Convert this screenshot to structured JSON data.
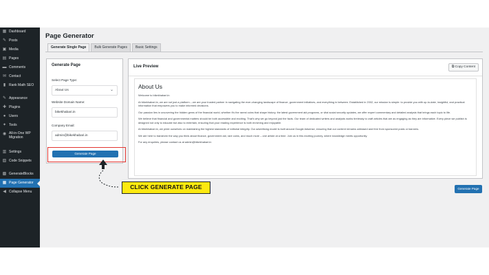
{
  "sidebar": {
    "items": [
      {
        "icon": "dashboard-icon",
        "glyph": "▦",
        "label": "Dashboard"
      },
      {
        "icon": "pin-icon",
        "glyph": "✎",
        "label": "Posts"
      },
      {
        "icon": "media-icon",
        "glyph": "▣",
        "label": "Media"
      },
      {
        "icon": "pages-icon",
        "glyph": "▤",
        "label": "Pages"
      },
      {
        "icon": "comment-icon",
        "glyph": "▬",
        "label": "Comments"
      },
      {
        "icon": "mail-icon",
        "glyph": "✉",
        "label": "Contact"
      },
      {
        "icon": "chart-icon",
        "glyph": "▮",
        "label": "Rank Math SEO"
      },
      {
        "icon": "brush-icon",
        "glyph": "✎",
        "label": "Appearance"
      },
      {
        "icon": "plugin-icon",
        "glyph": "✚",
        "label": "Plugins"
      },
      {
        "icon": "user-icon",
        "glyph": "●",
        "label": "Users"
      },
      {
        "icon": "wrench-icon",
        "glyph": "✦",
        "label": "Tools"
      },
      {
        "icon": "migration-icon",
        "glyph": "◉",
        "label": "All-in-One WP Migration"
      },
      {
        "icon": "settings-icon",
        "glyph": "▥",
        "label": "Settings"
      },
      {
        "icon": "code-icon",
        "glyph": "▧",
        "label": "Code Snippets"
      },
      {
        "icon": "blocks-icon",
        "glyph": "▩",
        "label": "GenerateBlocks"
      },
      {
        "icon": "page-gen-icon",
        "glyph": "▦",
        "label": "Page Generator"
      },
      {
        "icon": "collapse-icon",
        "glyph": "◀",
        "label": "Collapse Menu"
      }
    ]
  },
  "header": {
    "title": "Page Generator"
  },
  "tabs": [
    {
      "label": "Generate Single Page"
    },
    {
      "label": "Bulk Generate Pages"
    },
    {
      "label": "Basic Settings"
    }
  ],
  "form": {
    "title": "Generate Page",
    "page_type_label": "Select Page Type:",
    "page_type_value": "About Us",
    "domain_label": "Website Domain Name:",
    "domain_value": "bikekhabari.in",
    "email_label": "Company Email:",
    "email_value": "admin@bikekhabari.in",
    "button_label": "Generate Page"
  },
  "preview": {
    "title": "Live Preview",
    "copy_label": "Copy Content",
    "heading": "About Us",
    "paragraphs": [
      "Welcome to bikekhabari.in",
      "At bikekhabari.in, we are not just a platform – we are your trusted partner in navigating the ever-changing landscape of finance, government initiatives, and everything in between. Established in 2002, our mission is simple: to provide you with up-to-date, insightful, and practical information that empowers you to make informed decisions.",
      "Our passion lies in uncovering the hidden gems of the financial world, whether it's the rarest coins that shape history, the latest government aid programs, or vital social security updates, we offer expert commentary and detailed analysis that brings each topic to life.",
      "We believe that financial and governmental matters should be both accessible and exciting. That's why we go beyond just the facts. Our team of dedicated writers and analysts works tirelessly to craft articles that are as engaging as they are informative. Every piece we publish is designed not only to educate but also to entertain, ensuring that your reading experience is both enriching and enjoyable.",
      "At bikekhabari.in, we pride ourselves on maintaining the highest standards of editorial integrity. Our advertising model is built around Google Adsense, ensuring that our content remains unbiased and free from sponsored posts or banners.",
      "We are here to transform the way you think about finance, government aid, rare coins, and much more – one article at a time. Join us in this exciting journey, where knowledge meets opportunity.",
      "For any enquiries, please contact us at admin@bikekhabari.in"
    ],
    "bottom_button_label": "Generate Page"
  },
  "annotation": {
    "callout": "CLICK GENERATE PAGE"
  },
  "colors": {
    "accent": "#2271b1",
    "sidebar": "#1d2327",
    "highlight": "#e3342f",
    "callout": "#fde910"
  }
}
